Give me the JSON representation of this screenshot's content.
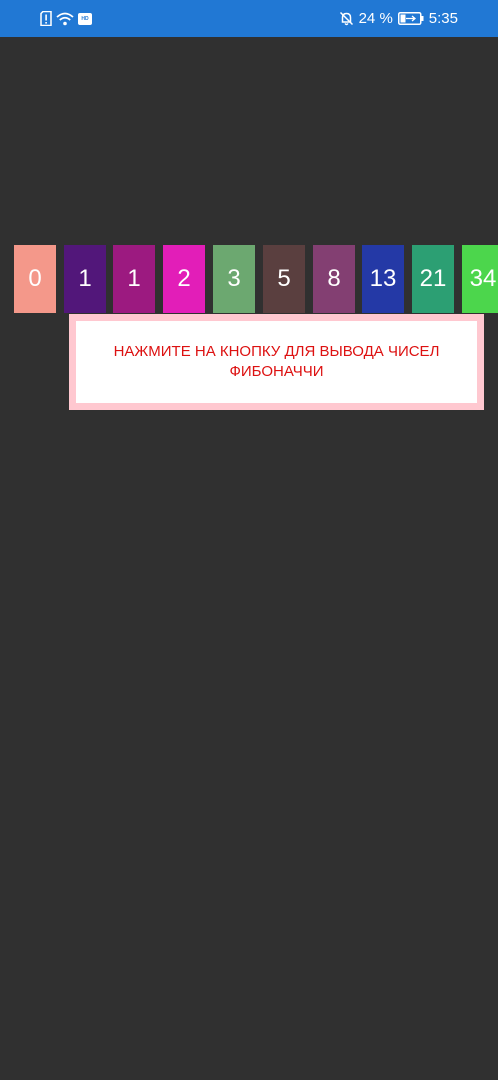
{
  "status_bar": {
    "left_icons": [
      "sim-alert-icon",
      "wifi-icon",
      "hd-icon"
    ],
    "hd_label": "HD",
    "right_icons": [
      "bell-off-icon",
      "battery-charging-icon"
    ],
    "battery_percent": "24 %",
    "time": "5:35",
    "background_color": "#2178d4"
  },
  "fibonacci": {
    "tiles": [
      {
        "label": "0",
        "color": "#f4988a"
      },
      {
        "label": "1",
        "color": "#52177a"
      },
      {
        "label": "1",
        "color": "#9c1a80"
      },
      {
        "label": "2",
        "color": "#e21eb8"
      },
      {
        "label": "3",
        "color": "#6ca870"
      },
      {
        "label": "5",
        "color": "#5a3f3f"
      },
      {
        "label": "8",
        "color": "#833f72"
      },
      {
        "label": "13",
        "color": "#2439a6"
      },
      {
        "label": "21",
        "color": "#2c9f73"
      },
      {
        "label": "34",
        "color": "#4cd64c"
      }
    ]
  },
  "message": {
    "text": "НАЖМИТЕ НА КНОПКУ ДЛЯ ВЫВОДА ЧИСЕЛ ФИБОНАЧЧИ",
    "text_color": "#dd1111",
    "border_color": "#ffc8d0"
  },
  "background_color": "#303030"
}
